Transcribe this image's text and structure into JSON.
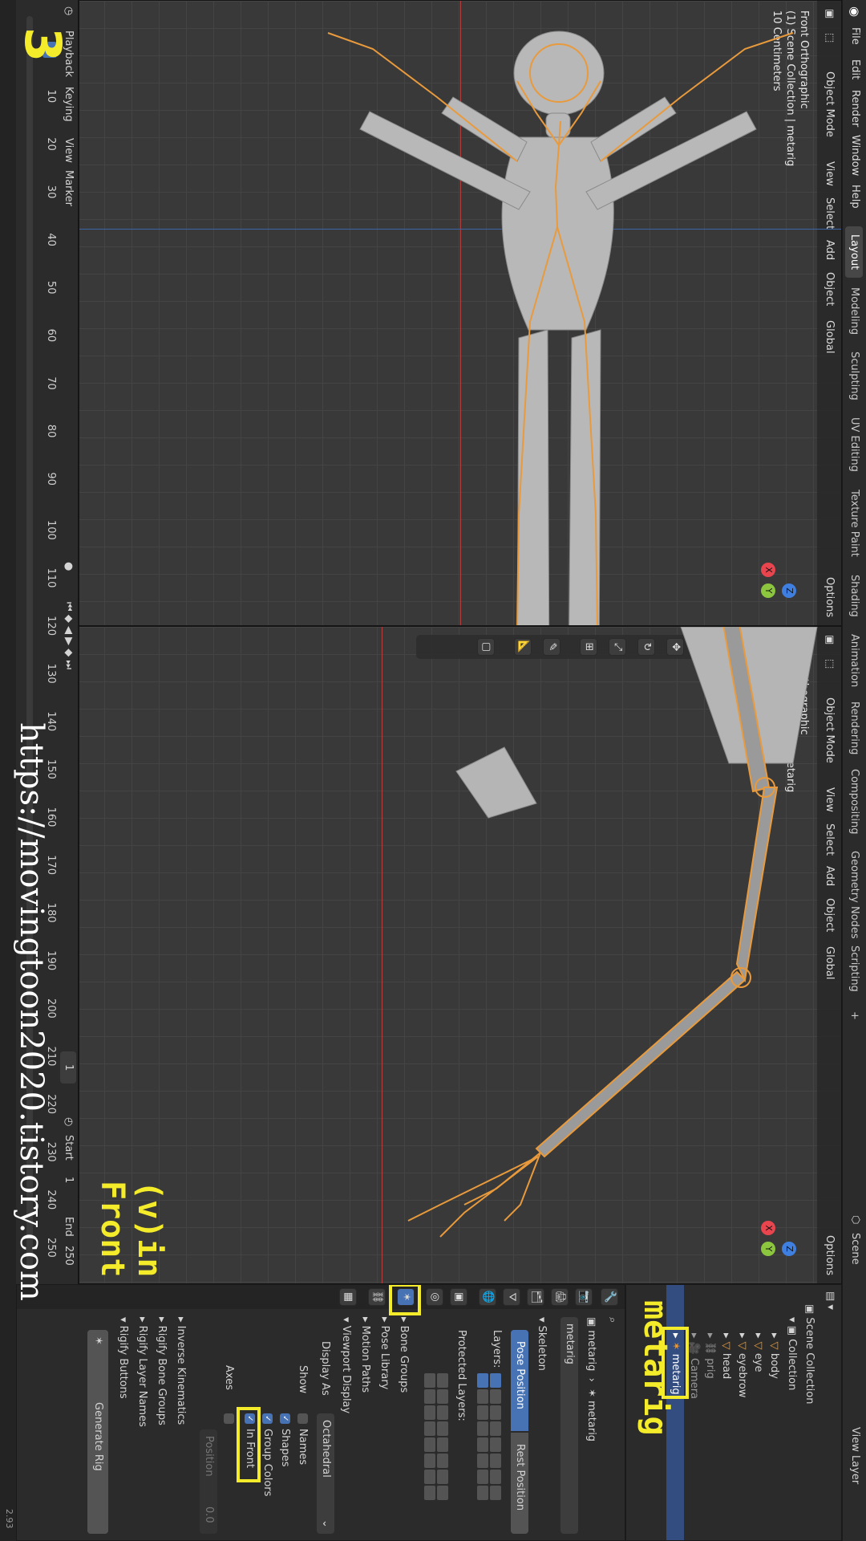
{
  "menu": [
    "File",
    "Edit",
    "Render",
    "Window",
    "Help"
  ],
  "workspace_tabs": [
    "Layout",
    "Modeling",
    "Sculpting",
    "UV Editing",
    "Texture Paint",
    "Shading",
    "Animation",
    "Rendering",
    "Compositing",
    "Geometry Nodes",
    "Scripting"
  ],
  "workspace_add": "+",
  "scene": {
    "label": "Scene",
    "view_layer": "View Layer"
  },
  "viewport": {
    "mode": "Object Mode",
    "menus": [
      "View",
      "Select",
      "Add",
      "Object"
    ],
    "orientation": "Global",
    "options": "Options",
    "hud": [
      "Front Orthographic",
      "(1) Scene Collection | metarig",
      "10 Centimeters"
    ],
    "gizmo": {
      "x": "X",
      "y": "Y",
      "z": "Z"
    }
  },
  "outliner": {
    "root": "Scene Collection",
    "collection": "Collection",
    "items": [
      "body",
      "eye",
      "eyebrow",
      "head",
      "prig",
      "Camera",
      "metarig"
    ]
  },
  "properties": {
    "object_name": "metarig",
    "data_name": "metarig",
    "skeleton": "Skeleton",
    "pose_position": "Pose Position",
    "rest_position": "Rest Position",
    "layers_label": "Layers:",
    "protected_layers": "Protected Layers:",
    "sections": [
      "Bone Groups",
      "Pose Library",
      "Motion Paths"
    ],
    "viewport_display": "Viewport Display",
    "display_as_label": "Display As",
    "display_as_value": "Octahedral",
    "show_label": "Show",
    "show_items": [
      "Names",
      "Shapes",
      "Group Colors",
      "In Front"
    ],
    "axes_label": "Axes",
    "axes_position": "Position",
    "axes_value": "0.0",
    "bottom_sections": [
      "Inverse Kinematics",
      "Rigify Bone Groups",
      "Rigify Layer Names",
      "Rigify Buttons"
    ],
    "generate_rig": "Generate Rig"
  },
  "timeline": {
    "menus": [
      "Playback",
      "Keying",
      "View",
      "Marker"
    ],
    "ticks": [
      "10",
      "20",
      "30",
      "40",
      "50",
      "60",
      "70",
      "80",
      "90",
      "100",
      "110",
      "120",
      "130",
      "140",
      "150",
      "160",
      "170",
      "180",
      "190",
      "200",
      "210",
      "220",
      "230",
      "240",
      "250"
    ],
    "current_frame": "1",
    "frame_field": "1",
    "start_label": "Start",
    "start_value": "1",
    "end_label": "End",
    "end_value": "250"
  },
  "status": {
    "version": "2.93"
  },
  "annotations": {
    "step": "3",
    "url": "https://movingtoon2020.tistory.com",
    "metarig": "metarig",
    "in_front": "(v)in Front"
  },
  "colors": {
    "highlight": "#f4ec2a",
    "accent": "#4772b3",
    "bone": "#e89a3c",
    "gizmo_x": "#e8454f",
    "gizmo_y": "#8cc63f",
    "gizmo_z": "#3f7fe0"
  }
}
